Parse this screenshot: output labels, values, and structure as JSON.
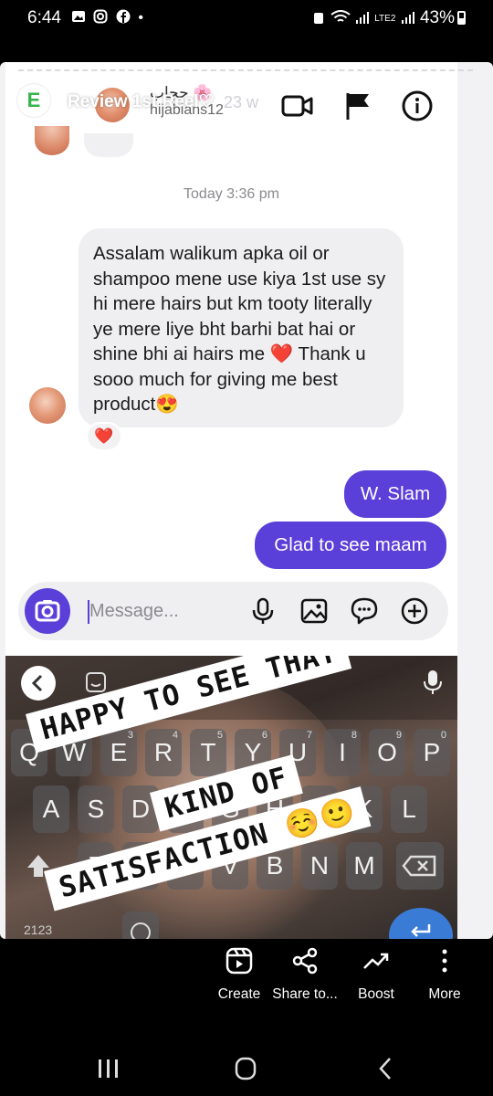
{
  "status_bar": {
    "time": "6:44",
    "notification_icons": [
      "gallery-icon",
      "instagram-icon",
      "facebook-icon",
      "dot"
    ],
    "battery": "43%",
    "network": "LTE2"
  },
  "story": {
    "avatar_letter": "E",
    "title": "Review 1st Reel♡",
    "age": "23 w"
  },
  "dm_header": {
    "name": "حجاب 🌸",
    "handle": "hijabians12"
  },
  "conversation": {
    "timestamp": "Today 3:36 pm",
    "incoming_message": "Assalam walikum\napka oil or shampoo mene use kiya 1st use sy hi mere hairs but km tooty literally ye mere liye bht barhi bat hai or shine bhi ai hairs me ❤️ Thank u sooo much for giving me best product😍",
    "reaction": "❤️",
    "outgoing_messages": [
      "W. Slam",
      "Glad to see maam"
    ]
  },
  "composer": {
    "placeholder": "Message..."
  },
  "keyboard": {
    "top_row": [
      "Q",
      "W",
      "E",
      "R",
      "T",
      "Y",
      "U",
      "I",
      "O",
      "P"
    ],
    "top_row_numbers": [
      "1",
      "2",
      "3",
      "4",
      "5",
      "6",
      "7",
      "8",
      "9",
      "0"
    ],
    "middle_row": [
      "A",
      "S",
      "D",
      "F",
      "G",
      "H",
      "J",
      "K",
      "L"
    ],
    "bottom_row": [
      "Z",
      "X",
      "C",
      "V",
      "B",
      "N",
      "M"
    ],
    "symbols_key": "2123"
  },
  "overlay_captions": {
    "line1": "HAPPY TO SEE THAT",
    "line2": "KIND OF",
    "line3": "SATISFACTION ☺️🙂"
  },
  "actions": {
    "create": "Create",
    "share": "Share to...",
    "boost": "Boost",
    "more": "More"
  },
  "colors": {
    "accent": "#5a3fd8",
    "story_badge": "#34b44b"
  }
}
